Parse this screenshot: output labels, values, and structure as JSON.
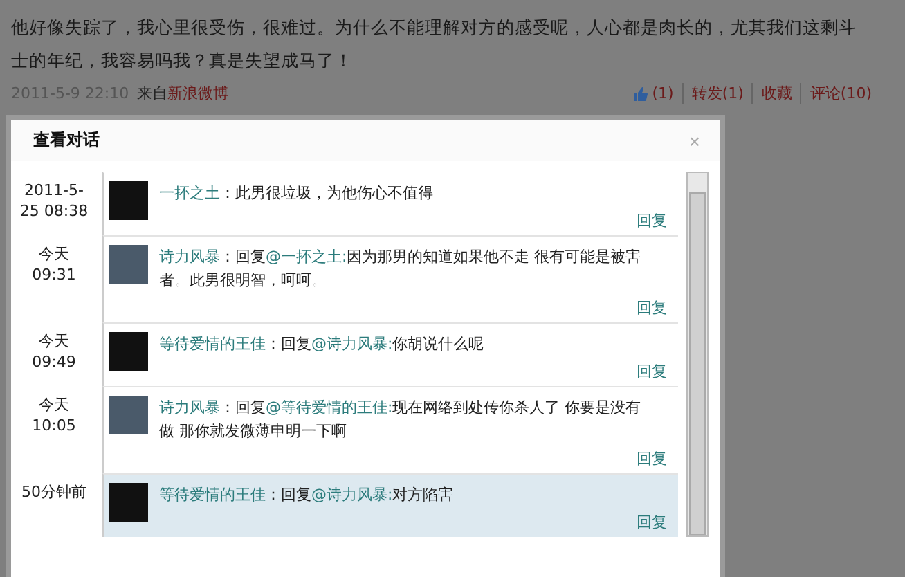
{
  "post": {
    "text": "他好像失踪了，我心里很受伤，很难过。为什么不能理解对方的感受呢，人心都是肉长的，尤其我们这剩斗士的年纪，我容易吗我？真是失望成马了！",
    "time": "2011-5-9 22:10",
    "source_prefix": "来自",
    "source": "新浪微博",
    "actions": [
      "(1)",
      "转发(1)",
      "收藏",
      "评论(10)"
    ]
  },
  "dialog": {
    "title": "查看对话",
    "close": "×",
    "messages": [
      {
        "time": "2011-5-25 08:38",
        "name": "一抔之土",
        "separator": "：",
        "text": "此男很垃圾，为他伤心不值得",
        "reply": "回复",
        "selected": false
      },
      {
        "time": "今天 09:31",
        "name": "诗力风暴",
        "separator": "：",
        "reply_label": "回复",
        "reply_to": "@一抔之土:",
        "text": "因为那男的知道如果他不走 很有可能是被害者。此男很明智，呵呵。",
        "reply": "回复",
        "selected": false
      },
      {
        "time": "今天 09:49",
        "name": "等待爱情的王佳",
        "separator": "：",
        "reply_label": "回复",
        "reply_to": "@诗力风暴:",
        "text": "你胡说什么呢",
        "reply": "回复",
        "selected": false
      },
      {
        "time": "今天 10:05",
        "name": "诗力风暴",
        "separator": "：",
        "reply_label": "回复",
        "reply_to": "@等待爱情的王佳:",
        "text": "现在网络到处传你杀人了 你要是没有做 那你就发微薄申明一下啊",
        "reply": "回复",
        "selected": false
      },
      {
        "time": "50分钟前",
        "name": "等待爱情的王佳",
        "separator": "：",
        "reply_label": "回复",
        "reply_to": "@诗力风暴:",
        "text": "对方陷害",
        "reply": "回复",
        "selected": true
      }
    ]
  }
}
